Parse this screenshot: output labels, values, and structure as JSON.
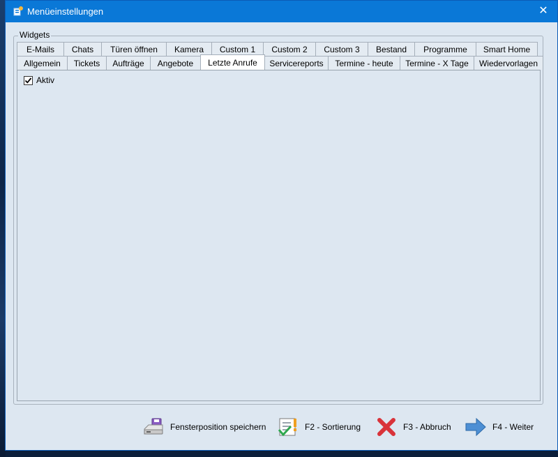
{
  "window": {
    "title": "Menüeinstellungen",
    "close_glyph": "✕"
  },
  "group": {
    "label": "Widgets"
  },
  "tabs_row1": [
    "E-Mails",
    "Chats",
    "Türen öffnen",
    "Kamera",
    "Custom 1",
    "Custom 2",
    "Custom 3",
    "Bestand",
    "Programme",
    "Smart Home"
  ],
  "tabs_row2": [
    "Allgemein",
    "Tickets",
    "Aufträge",
    "Angebote",
    "Letzte Anrufe",
    "Servicereports",
    "Termine - heute",
    "Termine - X Tage",
    "Wiedervorlagen"
  ],
  "active_tab": "Letzte Anrufe",
  "panel": {
    "checkbox_label": "Aktiv",
    "checked": true
  },
  "footer": {
    "save_position": "Fensterposition speichern",
    "sort": "F2 - Sortierung",
    "cancel": "F3 - Abbruch",
    "next": "F4 - Weiter"
  },
  "icons": {
    "app": "app-settings-icon",
    "save": "disk-drive-icon",
    "sort": "checklist-icon",
    "cancel": "red-x-icon",
    "next": "arrow-right-icon"
  },
  "colors": {
    "titlebar": "#0a78d7",
    "window_bg": "#dde7f1",
    "accent_red": "#d9333a",
    "accent_blue": "#4d8fd4"
  }
}
